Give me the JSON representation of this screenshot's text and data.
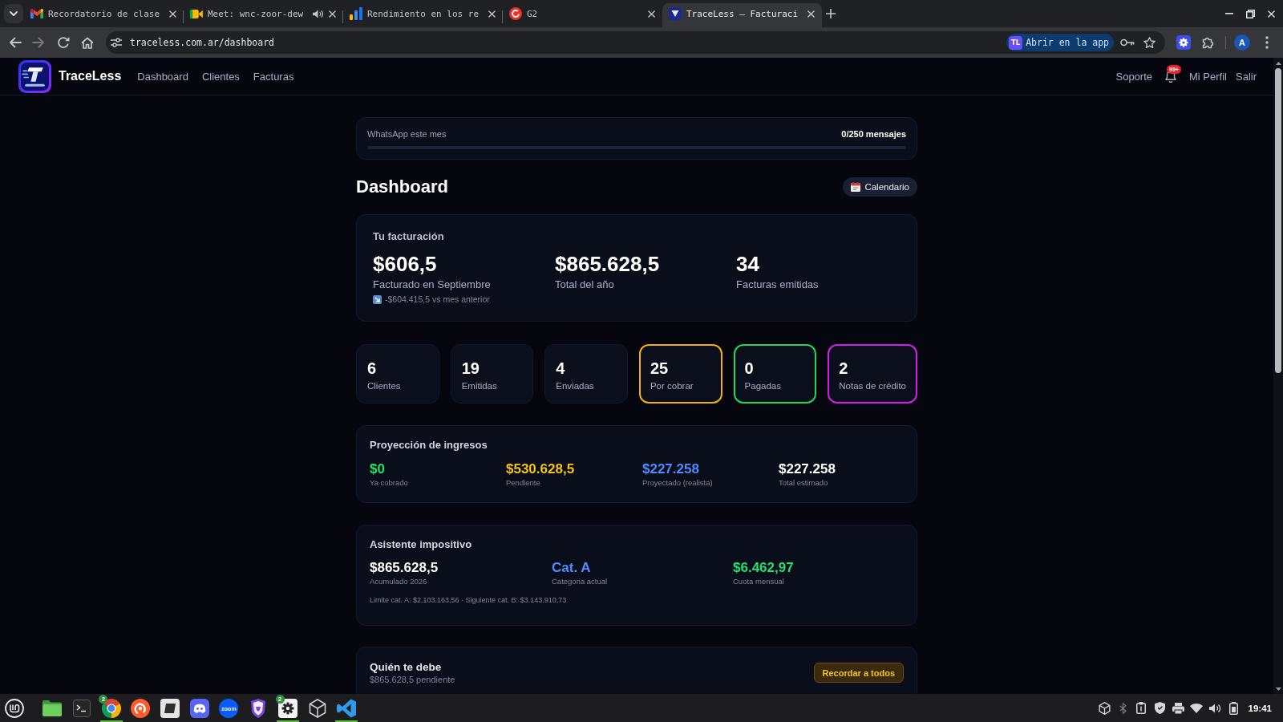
{
  "browser": {
    "tabs": [
      {
        "title": "Recordatorio de clase",
        "selected": false,
        "audio": false
      },
      {
        "title": "Meet: wnc-zoor-dew",
        "selected": false,
        "audio": true
      },
      {
        "title": "Rendimiento en los re",
        "selected": false,
        "audio": false
      },
      {
        "title": "G2",
        "selected": false,
        "audio": false
      },
      {
        "title": "TraceLess — Facturaci",
        "selected": true,
        "audio": false
      }
    ],
    "url": "traceless.com.ar/dashboard",
    "app_chip": {
      "badge": "TL",
      "label": "Abrir en la app"
    },
    "avatar": "A"
  },
  "app": {
    "brand": "TraceLess",
    "nav": [
      {
        "label": "Dashboard",
        "selected": false
      },
      {
        "label": "Clientes",
        "selected": false
      },
      {
        "label": "Facturas",
        "selected": false
      }
    ],
    "support": "Soporte",
    "notifications": {
      "badge": "99+"
    },
    "profile": "Mi Perfil",
    "logout": "Salir"
  },
  "whatsapp": {
    "label": "WhatsApp este mes",
    "reading": "0/250 mensajes",
    "level": 0
  },
  "dashboard": {
    "title": "Dashboard",
    "calendar_button": "Calendario"
  },
  "billing": {
    "title": "Tu facturación",
    "metrics": [
      {
        "value": "$606,5",
        "label": "Facturado en Septiembre",
        "trend": "-$604.415,5 vs mes anterior"
      },
      {
        "value": "$865.628,5",
        "label": "Total del año"
      },
      {
        "value": "34",
        "label": "Facturas emitidas"
      }
    ]
  },
  "stats": [
    {
      "value": "6",
      "label": "Clientes"
    },
    {
      "value": "19",
      "label": "Emitidas"
    },
    {
      "value": "4",
      "label": "Enviadas"
    },
    {
      "value": "25",
      "label": "Por cobrar",
      "color": "#f2b00c"
    },
    {
      "value": "0",
      "label": "Pagadas",
      "color": "#1fd65f"
    },
    {
      "value": "2",
      "label": "Notas de crédito",
      "color": "#d21ef0"
    }
  ],
  "projection": {
    "title": "Proyección de ingresos",
    "items": [
      {
        "value": "$0",
        "label": "Ya cobrado",
        "color": "#22e06b"
      },
      {
        "value": "$530.628,5",
        "label": "Pendiente",
        "color": "#f5c518"
      },
      {
        "value": "$227.258",
        "label": "Proyectado (realista)",
        "color": "#4d8dff"
      },
      {
        "value": "$227.258",
        "label": "Total estimado",
        "color": "#ffffff"
      }
    ]
  },
  "tax": {
    "title": "Asistente impositivo",
    "items": [
      {
        "value": "$865.628,5",
        "label": "Acumulado 2026",
        "color": "#ffffff"
      },
      {
        "value": "Cat. A",
        "label": "Categoria actual",
        "color": "#4d8dff"
      },
      {
        "value": "$6.462,97",
        "label": "Cuota mensual",
        "color": "#22e06b"
      }
    ],
    "note": "Limite cat. A: $2.103.163,56 · Siguiente cat. B: $3.143.910,73"
  },
  "debtors": {
    "title": "Quién te debe",
    "subtitle": "$865.628,5 pendiente",
    "button": "Recordar a todos"
  },
  "taskbar": {
    "apps": [
      {
        "running": false
      },
      {
        "running": false
      },
      {
        "running": true,
        "badge": "2"
      },
      {
        "running": false
      },
      {
        "running": false
      },
      {
        "running": false
      },
      {
        "running": false,
        "label": "zoom"
      },
      {
        "running": false
      },
      {
        "running": true,
        "badge": "2"
      },
      {
        "running": false
      },
      {
        "running": true
      }
    ],
    "clock": "19:41"
  }
}
